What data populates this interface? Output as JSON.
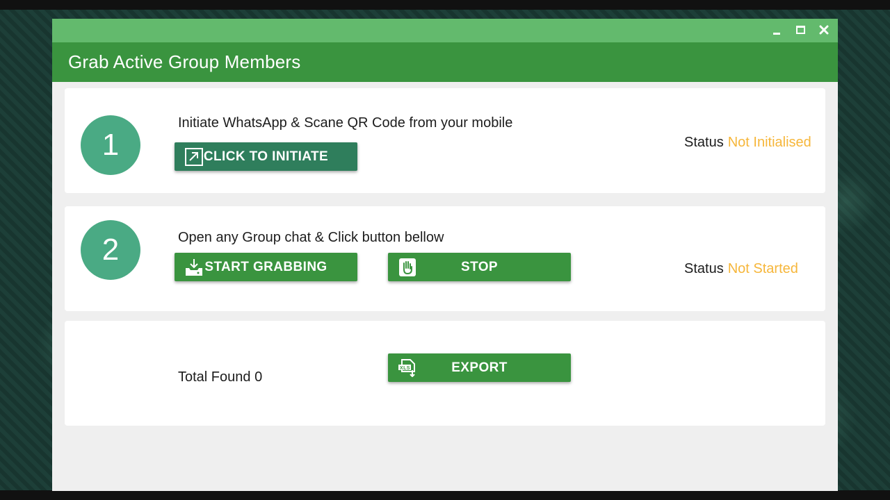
{
  "window": {
    "title": "Grab Active Group Members"
  },
  "step1": {
    "number": "1",
    "instruction": "Initiate WhatsApp & Scane QR Code from your mobile",
    "button_label": "CLICK TO INITIATE",
    "status_label": "Status",
    "status_value": "Not Initialised"
  },
  "step2": {
    "number": "2",
    "instruction": "Open any Group chat & Click button bellow",
    "start_label": "START GRABBING",
    "stop_label": "STOP",
    "status_label": "Status",
    "status_value": "Not Started"
  },
  "step3": {
    "total_label": "Total Found 0",
    "export_label": "EXPORT"
  },
  "colors": {
    "titlebar": "#63ba6d",
    "header": "#3a943f",
    "accent_button": "#3a943f",
    "initiate_button": "#2f7e5c",
    "step_circle": "#4aaa84",
    "status_value": "#f6b63a"
  },
  "icons": {
    "initiate": "external-link-icon",
    "start": "download-tray-icon",
    "stop": "hand-stop-icon",
    "export": "xls-export-icon"
  }
}
